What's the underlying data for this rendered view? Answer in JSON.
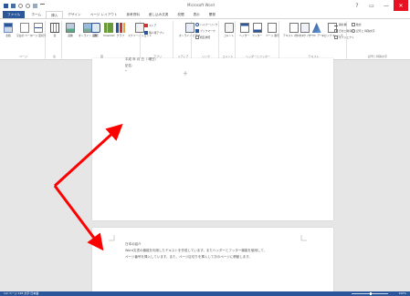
{
  "window": {
    "title": "Microsoft Word",
    "controls": [
      "?",
      "▭",
      "—",
      "✕"
    ]
  },
  "tabs": [
    {
      "label": "ファイル",
      "kind": "file"
    },
    {
      "label": "ホーム",
      "kind": "normal"
    },
    {
      "label": "挿入",
      "kind": "active"
    },
    {
      "label": "デザイン",
      "kind": "normal"
    },
    {
      "label": "ページ レイアウト",
      "kind": "normal"
    },
    {
      "label": "参考資料",
      "kind": "normal"
    },
    {
      "label": "差し込み文書",
      "kind": "normal"
    },
    {
      "label": "校閲",
      "kind": "normal"
    },
    {
      "label": "表示",
      "kind": "normal"
    },
    {
      "label": "開発",
      "kind": "normal"
    }
  ],
  "ribbon": {
    "groups": [
      {
        "label": "ページ",
        "buttons": [
          "表紙",
          "空白の ページ",
          "ページ 区切り"
        ]
      },
      {
        "label": "表",
        "buttons": [
          "表"
        ]
      },
      {
        "label": "図",
        "buttons": [
          "画像",
          "オンライン 画像",
          "図形",
          "SmartArt",
          "グラフ",
          "スクリーン ショット"
        ]
      },
      {
        "label": "アプリ",
        "buttons": [
          "ストア",
          "個人用アプリ"
        ]
      },
      {
        "label": "メディア",
        "buttons": [
          "オンライン ビデオ"
        ]
      },
      {
        "label": "リンク",
        "buttons": [
          "ハイパーリンク",
          "ブックマーク",
          "相互参照"
        ]
      },
      {
        "label": "コメント",
        "buttons": [
          "コメント"
        ]
      },
      {
        "label": "ヘッダーとフッター",
        "buttons": [
          "ヘッダー",
          "フッター",
          "ページ 番号"
        ]
      },
      {
        "label": "テキスト",
        "buttons": [
          "テキスト ボックス",
          "クイック パーツ",
          "ワード アート",
          "ドロップ キャップ"
        ]
      },
      {
        "label": "記号と特殊文字",
        "buttons": [
          "数式",
          "記号と 特殊文字"
        ]
      }
    ],
    "small": [
      "署名欄",
      "日付と時刻",
      "オブジェクト"
    ]
  },
  "document": {
    "page1_lines": [
      "平成 年 月 日（  曜日）",
      "記名："
    ],
    "page2_lines": [
      "日本の紹介",
      "Word文書の機能を利用したテキストを作成しています。またヘッダーとフッター機能を使用して、",
      "ページ番号を挿入しています。また、ページ区切りを挿入して次のページに移動します。"
    ]
  },
  "statusbar": {
    "left": "1/2 ページ   183 文字   日本語",
    "right": "100%"
  },
  "colors": {
    "accent": "#2b579a",
    "arrow": "#ff0000",
    "workspace": "#e6e6e6"
  }
}
